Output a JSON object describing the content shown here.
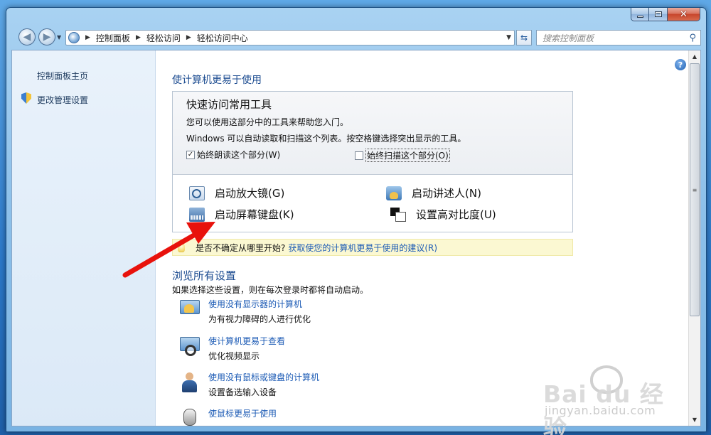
{
  "window": {
    "controls": {
      "minimize": "minimize",
      "maximize": "maximize",
      "close": "✕"
    }
  },
  "address": {
    "breadcrumb": [
      "控制面板",
      "轻松访问",
      "轻松访问中心"
    ],
    "search_placeholder": "搜索控制面板"
  },
  "sidebar": {
    "home": "控制面板主页",
    "admin": "更改管理设置"
  },
  "main": {
    "heading": "使计算机更易于使用",
    "quick": {
      "title": "快速访问常用工具",
      "line1": "您可以使用这部分中的工具来帮助您入门。",
      "line2": "Windows 可以自动读取和扫描这个列表。按空格键选择突出显示的工具。",
      "checkbox_read": {
        "label": "始终朗读这个部分(W)",
        "checked": true
      },
      "checkbox_scan": {
        "label": "始终扫描这个部分(O)",
        "checked": false
      },
      "tools": {
        "magnifier": "启动放大镜(G)",
        "narrator": "启动讲述人(N)",
        "onscreen_keyboard": "启动屏幕键盘(K)",
        "high_contrast": "设置高对比度(U)"
      }
    },
    "tip": {
      "question": "是否不确定从哪里开始?",
      "link": "获取使您的计算机更易于使用的建议(R)"
    },
    "browse": {
      "heading": "浏览所有设置",
      "subtitle": "如果选择这些设置，则在每次登录时都将自动启动。",
      "items": [
        {
          "link": "使用没有显示器的计算机",
          "desc": "为有视力障碍的人进行优化"
        },
        {
          "link": "使计算机更易于查看",
          "desc": "优化视频显示"
        },
        {
          "link": "使用没有鼠标或键盘的计算机",
          "desc": "设置备选输入设备"
        },
        {
          "link": "使鼠标更易于使用",
          "desc": ""
        }
      ]
    },
    "help": "?"
  },
  "watermark": {
    "main": "Bai du 经验",
    "sub": "jingyan.baidu.com"
  },
  "colors": {
    "link": "#1c5bb5",
    "heading": "#1b4b90",
    "annotation_arrow": "#e8120c",
    "tip_bg": "#fbf8d2"
  }
}
